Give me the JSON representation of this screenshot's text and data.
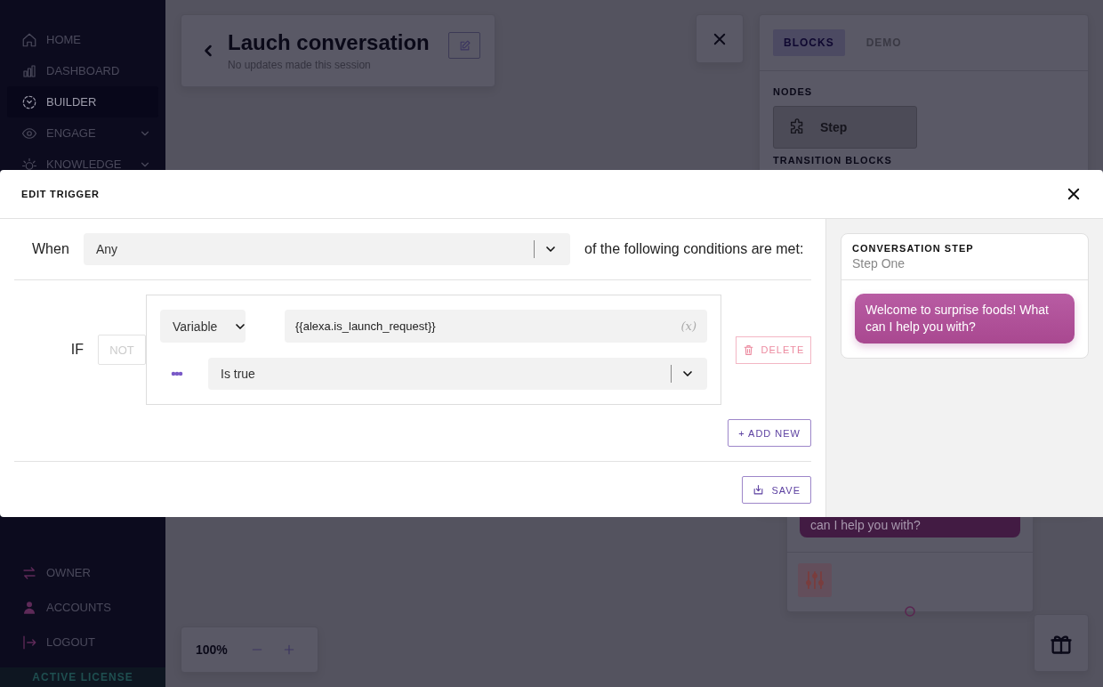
{
  "sidebar": {
    "nav": [
      {
        "label": "HOME",
        "kind": "link",
        "selected": false
      },
      {
        "label": "DASHBOARD",
        "kind": "link",
        "selected": false
      },
      {
        "label": "BUILDER",
        "kind": "link",
        "selected": true
      },
      {
        "label": "ENGAGE",
        "kind": "group",
        "selected": false
      },
      {
        "label": "KNOWLEDGE",
        "kind": "group",
        "selected": false
      }
    ],
    "footer_nav": [
      {
        "label": "OWNER"
      },
      {
        "label": "ACCOUNTS"
      },
      {
        "label": "LOGOUT"
      }
    ],
    "license": "ACTIVE LICENSE"
  },
  "header": {
    "title": "Lauch conversation",
    "subtitle": "No updates made this session"
  },
  "panel": {
    "tabs": [
      {
        "label": "BLOCKS",
        "selected": true
      },
      {
        "label": "DEMO",
        "selected": false
      }
    ],
    "nodes_heading": "NODES",
    "nodes": [
      {
        "label": "Step"
      }
    ],
    "transition_heading": "TRANSITION BLOCKS"
  },
  "canvas_node": {
    "message": "can I help you with?"
  },
  "zoom": {
    "value": "100%"
  },
  "modal": {
    "title": "EDIT TRIGGER",
    "match_label": "When",
    "match_value": "Any",
    "match_suffix": "of the following conditions are met:",
    "conditions": [
      {
        "prefix": "IF",
        "negated": false,
        "not_label": "NOT",
        "type_value": "Variable",
        "variable": "{{alexa.is_launch_request}}",
        "variable_hint": "(x)",
        "operator": "Is true",
        "delete_label": "DELETE"
      }
    ],
    "add_label": "+ ADD NEW",
    "save_label": "SAVE",
    "preview": {
      "heading": "CONVERSATION STEP",
      "name": "Step One",
      "message": "Welcome to surprise foods! What can I help you with?"
    }
  }
}
